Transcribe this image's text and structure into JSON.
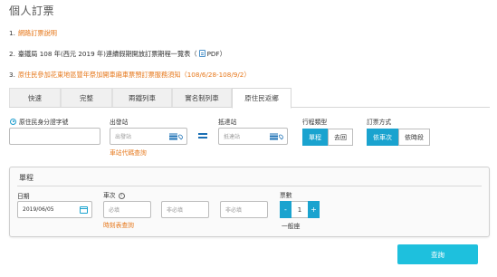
{
  "page": {
    "title": "個人訂票"
  },
  "notes": [
    {
      "num": "1.",
      "text": "網路訂票說明"
    },
    {
      "num": "2.",
      "text_before": "臺鐵局 108 年(西元 2019 年)連續假期開放訂票期程一覽表（",
      "pdf_label": "PDF",
      "text_after": "）"
    },
    {
      "num": "3.",
      "text": "原住民參加花東地區豐年祭加開車廂車票預訂票服務須知（108/6/28-108/9/2）"
    }
  ],
  "tabs": [
    "快速",
    "完整",
    "兩鐵列車",
    "實名制列車",
    "原住民返鄉"
  ],
  "form": {
    "id_radio_label": "原住民身分證字號",
    "from_label": "出發站",
    "from_placeholder": "出發站",
    "to_label": "抵達站",
    "to_placeholder": "抵達站",
    "station_code_link": "車站代碼查詢",
    "trip_type_label": "行程類型",
    "trip_type_options": [
      "單程",
      "去回"
    ],
    "booking_method_label": "訂票方式",
    "booking_method_options": [
      "依車次",
      "依時段"
    ]
  },
  "panel": {
    "title": "單程",
    "date_label": "日期",
    "date_value": "2019/06/05",
    "train_label": "車次",
    "train_placeholders": [
      "必填",
      "非必填",
      "非必填"
    ],
    "timetable_link": "時刻表查詢",
    "ticket_count_label": "票數",
    "minus": "-",
    "count": "1",
    "plus": "+",
    "seat_type": "一般座"
  },
  "search_button": "查詢",
  "colors": {
    "accent": "#1aa3cf",
    "search": "#1ec0dd",
    "link_orange": "#e6771a",
    "icon_blue": "#1a6fb4"
  },
  "icons": [
    "pdf-icon",
    "list-icon",
    "map-pin-icon",
    "swap-icon",
    "info-icon",
    "calendar-icon"
  ]
}
